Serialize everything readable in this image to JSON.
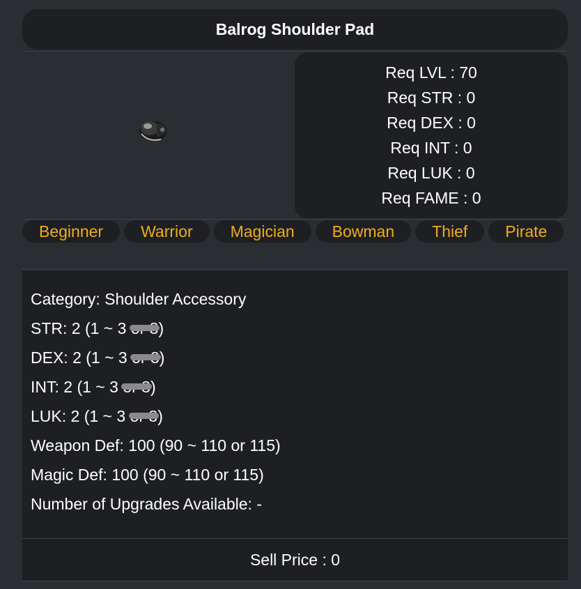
{
  "item": {
    "title": "Balrog Shoulder Pad"
  },
  "requirements": [
    {
      "label": "Req LVL : 70"
    },
    {
      "label": "Req STR : 0"
    },
    {
      "label": "Req DEX : 0"
    },
    {
      "label": "Req INT : 0"
    },
    {
      "label": "Req LUK : 0"
    },
    {
      "label": "Req FAME : 0"
    }
  ],
  "jobs": [
    "Beginner",
    "Warrior",
    "Magician",
    "Bowman",
    "Thief",
    "Pirate"
  ],
  "stats": {
    "category": "Category: Shoulder Accessory",
    "str": {
      "prefix": "STR: 2 (1 ~ 3 ",
      "scribbled": "or 8",
      "suffix": ")"
    },
    "dex": {
      "prefix": "DEX: 2 (1 ~ 3 ",
      "scribbled": "or 8",
      "suffix": ")"
    },
    "int": {
      "prefix": "INT: 2 (1 ~ 3 ",
      "scribbled": "or 8",
      "suffix": ")"
    },
    "luk": {
      "prefix": "LUK: 2 (1 ~ 3 ",
      "scribbled": "or 8",
      "suffix": ")"
    },
    "weapon_def": "Weapon Def: 100 (90 ~ 110 or 115)",
    "magic_def": "Magic Def: 100 (90 ~ 110 or 115)",
    "upgrades": "Number of Upgrades Available: -"
  },
  "sell_price": "Sell Price : 0",
  "colors": {
    "background": "#2a2d32",
    "panel": "#1d1f23",
    "job_text": "#f0ad1a",
    "text": "#ffffff"
  },
  "icons": {
    "item_icon": "shoulder-pad-icon"
  }
}
